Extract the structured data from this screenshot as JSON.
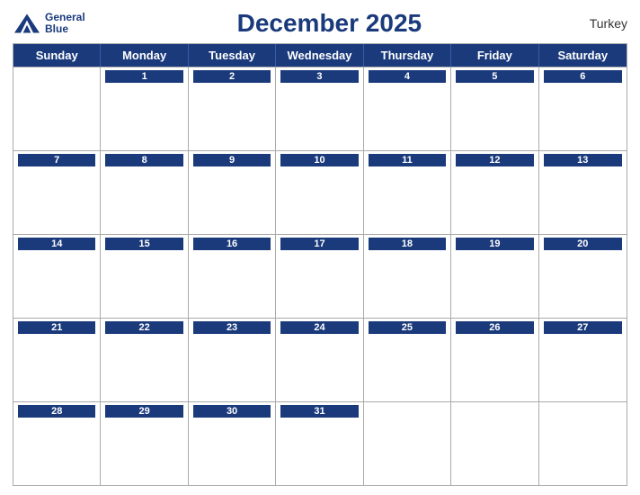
{
  "header": {
    "title": "December 2025",
    "country": "Turkey",
    "logo_line1": "General",
    "logo_line2": "Blue"
  },
  "days_of_week": [
    "Sunday",
    "Monday",
    "Tuesday",
    "Wednesday",
    "Thursday",
    "Friday",
    "Saturday"
  ],
  "weeks": [
    [
      {
        "num": "",
        "empty": true
      },
      {
        "num": "1",
        "empty": false
      },
      {
        "num": "2",
        "empty": false
      },
      {
        "num": "3",
        "empty": false
      },
      {
        "num": "4",
        "empty": false
      },
      {
        "num": "5",
        "empty": false
      },
      {
        "num": "6",
        "empty": false
      }
    ],
    [
      {
        "num": "7",
        "empty": false
      },
      {
        "num": "8",
        "empty": false
      },
      {
        "num": "9",
        "empty": false
      },
      {
        "num": "10",
        "empty": false
      },
      {
        "num": "11",
        "empty": false
      },
      {
        "num": "12",
        "empty": false
      },
      {
        "num": "13",
        "empty": false
      }
    ],
    [
      {
        "num": "14",
        "empty": false
      },
      {
        "num": "15",
        "empty": false
      },
      {
        "num": "16",
        "empty": false
      },
      {
        "num": "17",
        "empty": false
      },
      {
        "num": "18",
        "empty": false
      },
      {
        "num": "19",
        "empty": false
      },
      {
        "num": "20",
        "empty": false
      }
    ],
    [
      {
        "num": "21",
        "empty": false
      },
      {
        "num": "22",
        "empty": false
      },
      {
        "num": "23",
        "empty": false
      },
      {
        "num": "24",
        "empty": false
      },
      {
        "num": "25",
        "empty": false
      },
      {
        "num": "26",
        "empty": false
      },
      {
        "num": "27",
        "empty": false
      }
    ],
    [
      {
        "num": "28",
        "empty": false
      },
      {
        "num": "29",
        "empty": false
      },
      {
        "num": "30",
        "empty": false
      },
      {
        "num": "31",
        "empty": false
      },
      {
        "num": "",
        "empty": true
      },
      {
        "num": "",
        "empty": true
      },
      {
        "num": "",
        "empty": true
      }
    ]
  ],
  "colors": {
    "header_bg": "#1a3a7c",
    "accent": "#1a3a7c"
  }
}
